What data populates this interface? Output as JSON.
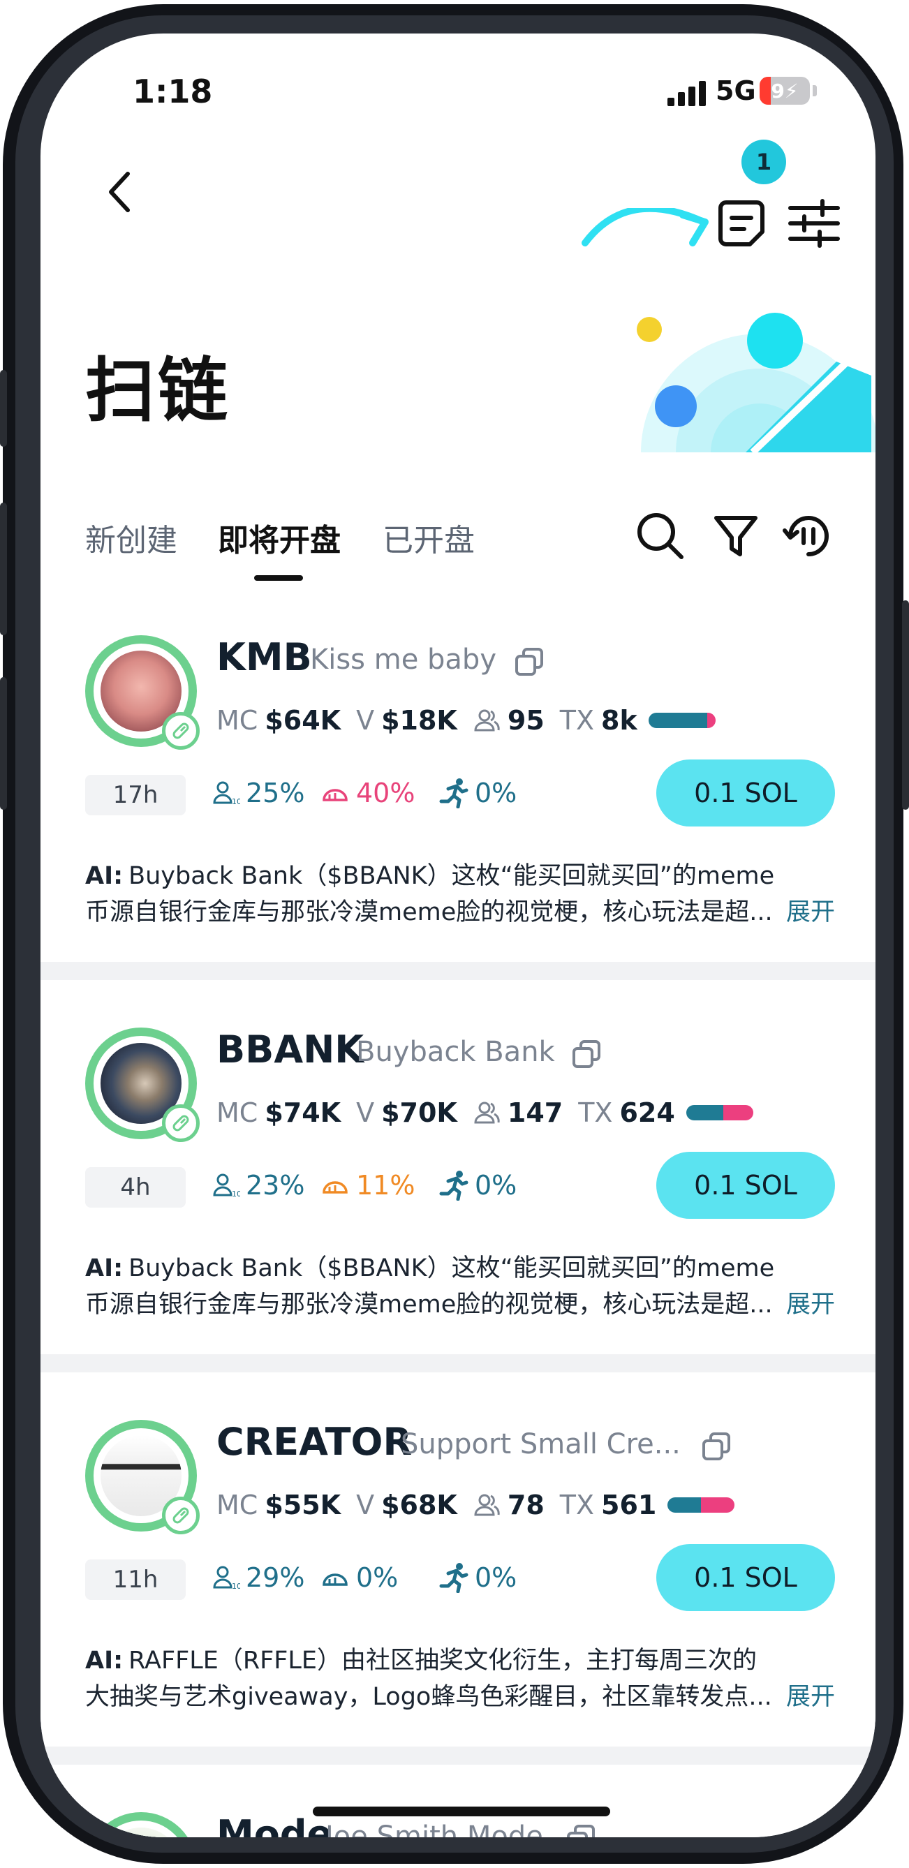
{
  "status_bar": {
    "time": "1:18",
    "network": "5G",
    "battery": "9"
  },
  "header": {
    "notification_count": "1"
  },
  "page": {
    "title": "扫链"
  },
  "tabs": [
    {
      "label": "新创建",
      "active": false
    },
    {
      "label": "即将开盘",
      "active": true
    },
    {
      "label": "已开盘",
      "active": false
    }
  ],
  "labels": {
    "mc": "MC",
    "v": "V",
    "tx": "TX",
    "ai": "AI:",
    "expand": "展开"
  },
  "tokens": [
    {
      "symbol": "KMB",
      "name": "Kiss me baby",
      "mc": "$64K",
      "volume": "$18K",
      "holders": "95",
      "tx": "8k",
      "tx_buy_ratio": 0.88,
      "age": "17h",
      "top10_pct": "25%",
      "dev_pct": "40%",
      "dev_color": "#e8437a",
      "sniper_pct": "0%",
      "buy_label": "0.1 SOL",
      "ai_line1": "Buyback Bank（$BBANK）这枚“能买回就买回”的meme",
      "ai_line2": "币源自银行金库与那张冷漠meme脸的视觉梗，核心玩法是超..."
    },
    {
      "symbol": "BBANK",
      "name": "Buyback Bank",
      "mc": "$74K",
      "volume": "$70K",
      "holders": "147",
      "tx": "624",
      "tx_buy_ratio": 0.55,
      "age": "4h",
      "top10_pct": "23%",
      "dev_pct": "11%",
      "dev_color": "#f08a24",
      "sniper_pct": "0%",
      "buy_label": "0.1 SOL",
      "ai_line1": "Buyback Bank（$BBANK）这枚“能买回就买回”的meme",
      "ai_line2": "币源自银行金库与那张冷漠meme脸的视觉梗，核心玩法是超..."
    },
    {
      "symbol": "CREATOR",
      "name": "Support Small Cre...",
      "mc": "$55K",
      "volume": "$68K",
      "holders": "78",
      "tx": "561",
      "tx_buy_ratio": 0.5,
      "age": "11h",
      "top10_pct": "29%",
      "dev_pct": "0%",
      "dev_color": "#1f6f8a",
      "sniper_pct": "0%",
      "buy_label": "0.1 SOL",
      "ai_line1": "RAFFLE（RFFLE）由社区抽奖文化衍生，主打每周三次的",
      "ai_line2": "大抽奖与艺术giveaway，Logo蜂鸟色彩醒目，社区靠转发点..."
    },
    {
      "symbol": "Mode",
      "name": "Joe Smith Mode"
    }
  ]
}
